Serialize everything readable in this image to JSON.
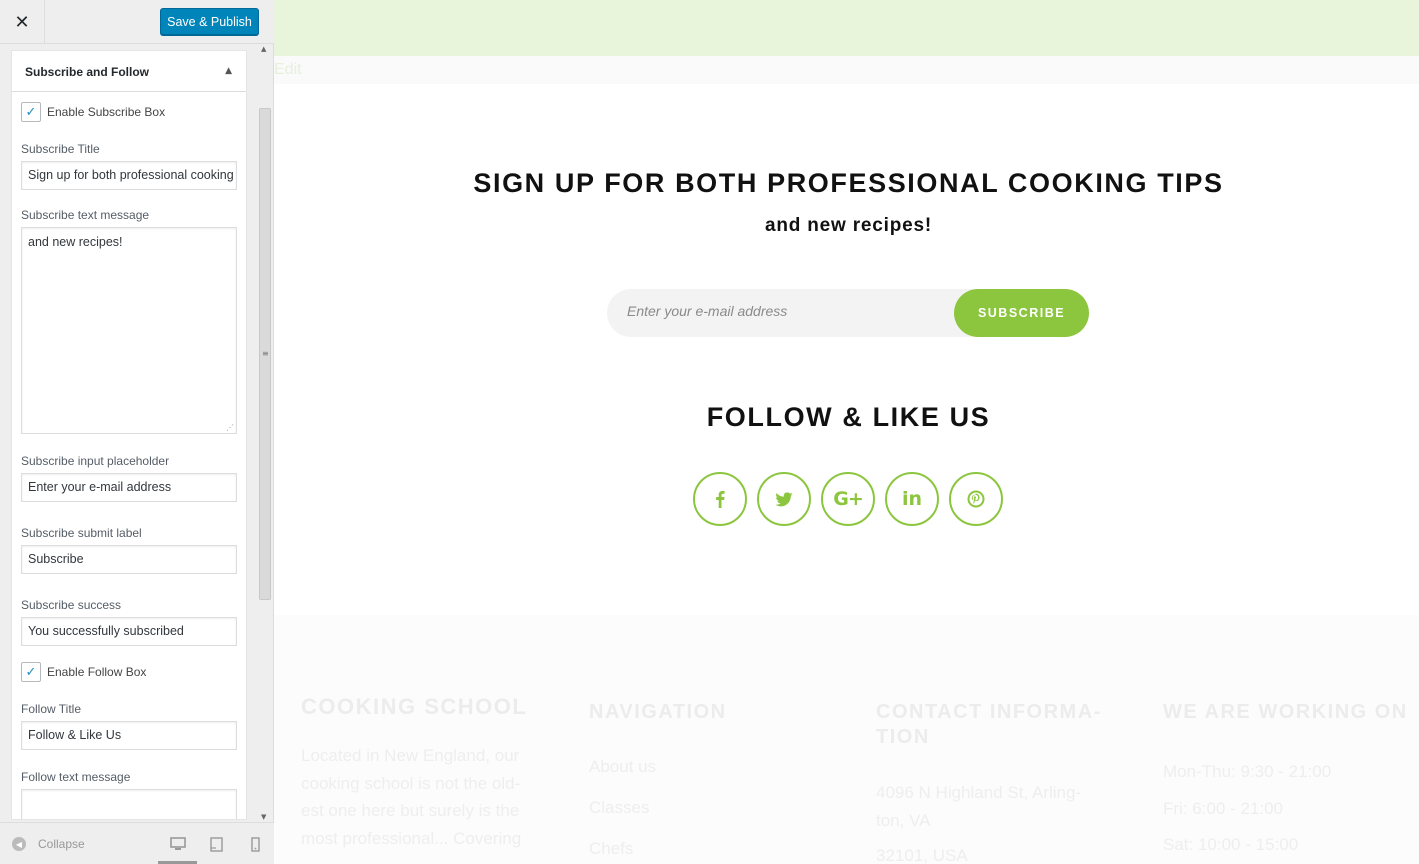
{
  "sidebar": {
    "close_icon": "close-icon",
    "save_label": "Save & Publish",
    "section_title": "Subscribe and Follow",
    "enable_subscribe_label": "Enable Subscribe Box",
    "enable_subscribe_checked": true,
    "subscribe_title_label": "Subscribe Title",
    "subscribe_title_value": "Sign up for both professional cooking tips",
    "subscribe_text_label": "Subscribe text message",
    "subscribe_text_value": "and new recipes!",
    "placeholder_label": "Subscribe input placeholder",
    "placeholder_value": "Enter your e-mail address",
    "submit_label_label": "Subscribe submit label",
    "submit_label_value": "Subscribe",
    "success_label": "Subscribe success",
    "success_value": "You successfully subscribed",
    "enable_follow_label": "Enable Follow Box",
    "enable_follow_checked": true,
    "follow_title_label": "Follow Title",
    "follow_title_value": "Follow & Like Us",
    "follow_text_label": "Follow text message",
    "follow_text_value": "",
    "collapse_label": "Collapse",
    "devices": [
      "desktop-icon",
      "tablet-icon",
      "mobile-icon"
    ]
  },
  "preview": {
    "edit_label": "Edit",
    "subscribe_title": "Sign up for both professional cooking tips",
    "subscribe_text": "and new recipes!",
    "input_placeholder": "Enter your e-mail address",
    "subscribe_button": "Subscribe",
    "follow_title": "Follow & Like Us",
    "social": [
      {
        "name": "facebook-icon",
        "glyph": "f"
      },
      {
        "name": "twitter-icon",
        "glyph": "t"
      },
      {
        "name": "google-plus-icon",
        "glyph": "G+"
      },
      {
        "name": "linkedin-icon",
        "glyph": "in"
      },
      {
        "name": "pinterest-icon",
        "glyph": "p"
      }
    ],
    "accent_color": "#8cc63f"
  },
  "footer": {
    "about_title": "Cooking School",
    "about_lines": [
      "Located in New England, our",
      "cooking school is not the old-",
      "est one here but surely is the",
      "most professional... Covering"
    ],
    "nav_title": "Navigation",
    "nav_links": [
      "About us",
      "Classes",
      "Chefs"
    ],
    "contact_title_lines": [
      "Contact Informa-",
      "tion"
    ],
    "contact_lines": [
      "4096 N Highland St, Arling-",
      "ton, VA",
      "32101, USA"
    ],
    "hours_title": "We are working on",
    "hours_lines": [
      "Mon-Thu: 9:30 - 21:00",
      "Fri: 6:00 - 21:00",
      "Sat: 10:00 - 15:00"
    ]
  }
}
